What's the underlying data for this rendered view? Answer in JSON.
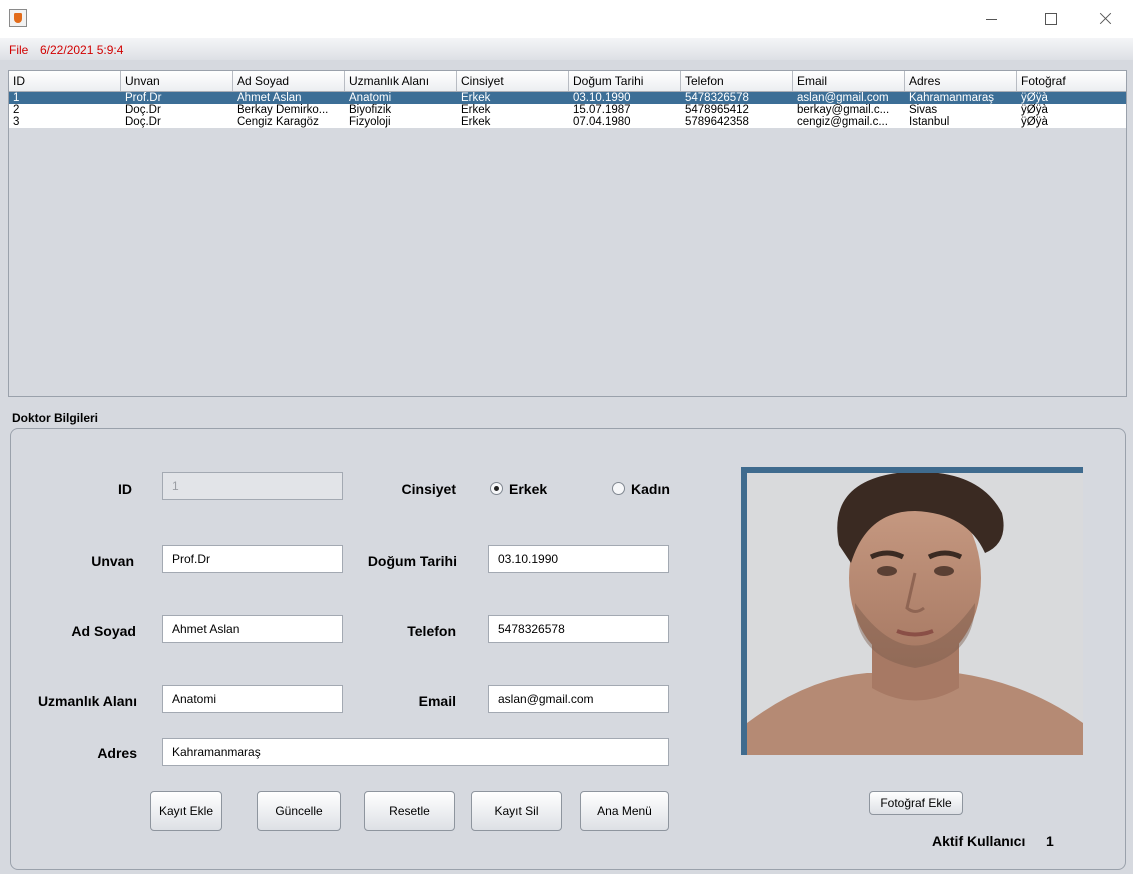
{
  "menu": {
    "file": "File",
    "clock": "6/22/2021  5:9:4"
  },
  "table": {
    "headers": [
      "ID",
      "Unvan",
      "Ad Soyad",
      "Uzmanlık Alanı",
      "Cinsiyet",
      "Doğum Tarihi",
      "Telefon",
      "Email",
      "Adres",
      "Fotoğraf"
    ],
    "rows": [
      [
        "1",
        "Prof.Dr",
        "Ahmet Aslan",
        "Anatomi",
        "Erkek",
        "03.10.1990",
        "5478326578",
        "aslan@gmail.com",
        "Kahramanmaraş",
        "ÿØÿà"
      ],
      [
        "2",
        "Doç.Dr",
        "Berkay Demirko...",
        "Biyofizik",
        "Erkek",
        "15.07.1987",
        "5478965412",
        "berkay@gmail.c...",
        "Sivas",
        "ÿØÿà"
      ],
      [
        "3",
        "Doç.Dr",
        "Cengiz Karagöz",
        "Fizyoloji",
        "Erkek",
        "07.04.1980",
        "5789642358",
        "cengiz@gmail.c...",
        "İstanbul",
        "ÿØÿà"
      ]
    ],
    "selected_row": 0
  },
  "form": {
    "title": "Doktor Bilgileri",
    "labels": {
      "id": "ID",
      "unvan": "Unvan",
      "ad_soyad": "Ad Soyad",
      "uzmanlik": "Uzmanlık Alanı",
      "adres": "Adres",
      "cinsiyet": "Cinsiyet",
      "dogum": "Doğum Tarihi",
      "telefon": "Telefon",
      "email": "Email"
    },
    "values": {
      "id": "1",
      "unvan": "Prof.Dr",
      "ad_soyad": "Ahmet Aslan",
      "uzmanlik": "Anatomi",
      "adres": "Kahramanmaraş",
      "dogum": "03.10.1990",
      "telefon": "5478326578",
      "email": "aslan@gmail.com"
    },
    "gender": {
      "male": "Erkek",
      "female": "Kadın",
      "selected": "Erkek"
    }
  },
  "buttons": {
    "kayit_ekle": "Kayıt Ekle",
    "guncelle": "Güncelle",
    "resetle": "Resetle",
    "kayit_sil": "Kayıt Sil",
    "ana_menu": "Ana Menü",
    "fotograf_ekle": "Fotoğraf Ekle"
  },
  "status": {
    "active_user_label": "Aktif Kullanıcı",
    "active_user_value": "1"
  }
}
